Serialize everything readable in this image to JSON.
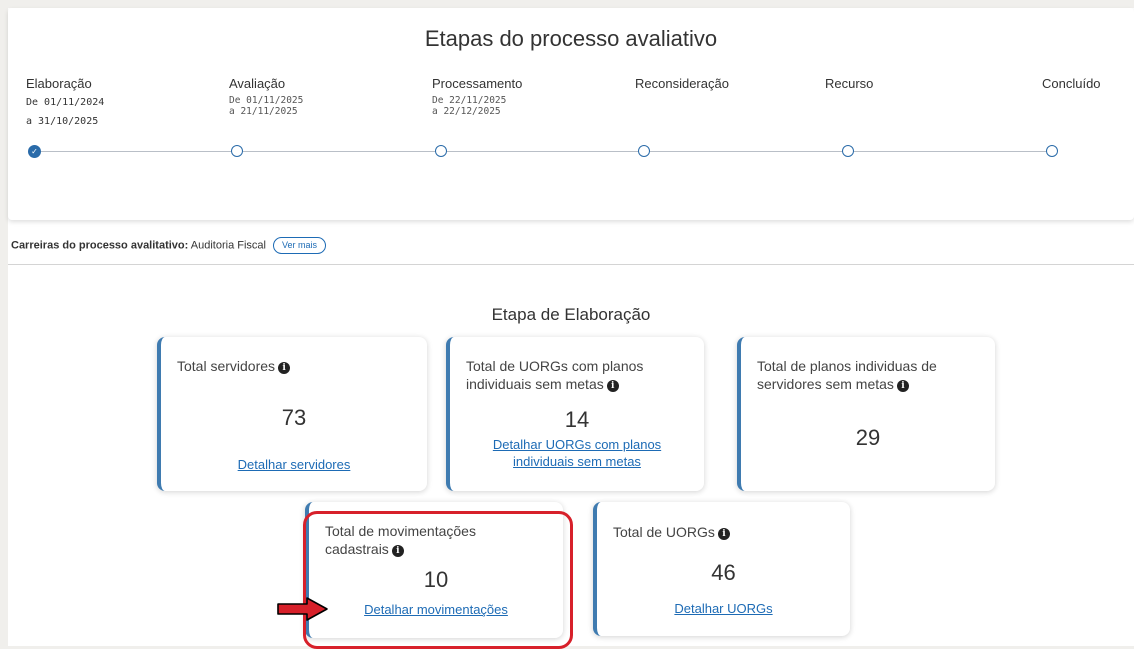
{
  "stepper": {
    "title": "Etapas do processo avaliativo",
    "steps": [
      {
        "name": "Elaboração",
        "from": "De 01/11/2024",
        "to": "a  31/10/2025",
        "status": "done"
      },
      {
        "name": "Avaliação",
        "from": "De 01/11/2025",
        "to": "a  21/11/2025",
        "status": "pending"
      },
      {
        "name": "Processamento",
        "from": "De 22/11/2025",
        "to": "a  22/12/2025",
        "status": "pending"
      },
      {
        "name": "Reconsideração",
        "from": "",
        "to": "",
        "status": "pending"
      },
      {
        "name": "Recurso",
        "from": "",
        "to": "",
        "status": "pending"
      },
      {
        "name": "Concluído",
        "from": "",
        "to": "",
        "status": "pending"
      }
    ]
  },
  "careers": {
    "label": "Carreiras do processo avalitativo",
    "value": "Auditoria Fiscal",
    "button": "Ver mais"
  },
  "stage": {
    "title": "Etapa de Elaboração"
  },
  "cards": {
    "servidores": {
      "title": "Total servidores",
      "value": "73",
      "link": "Detalhar servidores"
    },
    "uorgs_sem_metas": {
      "title": "Total de UORGs com planos individuais sem metas",
      "value": "14",
      "link": "Detalhar UORGs com planos individuais sem metas"
    },
    "planos_sem_metas": {
      "title": "Total de planos individuas de servidores sem metas",
      "value": "29"
    },
    "movimentacoes": {
      "title": "Total de movimentações cadastrais",
      "value": "10",
      "link": "Detalhar movimentações"
    },
    "uorgs": {
      "title": "Total de UORGs",
      "value": "46",
      "link": "Detalhar UORGs"
    }
  },
  "colors": {
    "accent": "#3f7bb0",
    "link": "#1d6bb5",
    "highlight": "#d7202a",
    "arrow": "#d7202a"
  },
  "icons": {
    "info": "info-icon",
    "check": "check-icon",
    "arrow": "arrow-right-icon"
  }
}
